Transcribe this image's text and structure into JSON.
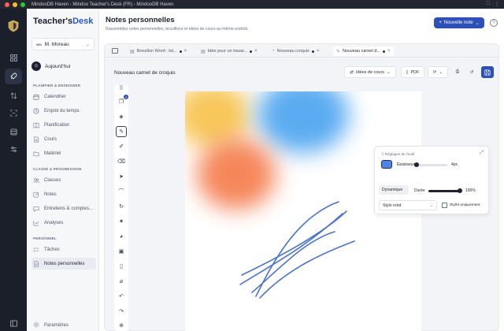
{
  "window": {
    "title": "MindooDB Haven - Mindoo Teacher's Desk (FR) - MindooDB Haven"
  },
  "brand": {
    "part1": "Teacher's",
    "part2": "Desk"
  },
  "user": {
    "initials": "MM",
    "name": "M. Moreau"
  },
  "today_label": "Aujourd'hui",
  "sections": {
    "plan": "PLANIFIER & ENSEIGNER",
    "class": "CLASSE & PROGRESSION",
    "personal": "PERSONNEL"
  },
  "nav": {
    "calendrier": "Calendrier",
    "emploi": "Emploi du temps",
    "planification": "Planification",
    "cours": "Cours",
    "materiel": "Matériel",
    "classes": "Classes",
    "notes": "Notes",
    "entretiens": "Entretiens & comptes...",
    "analyses": "Analyses",
    "taches": "Tâches",
    "notes_perso": "Notes personnelles",
    "parametres": "Paramètres"
  },
  "header": {
    "title": "Notes personnelles",
    "subtitle": "Rassemblez notes personnelles, brouillons et idées de cours au même endroit.",
    "new_note": "Nouvelle note",
    "help": "?"
  },
  "tabs": [
    {
      "label": "Brouillon Word : let..."
    },
    {
      "label": "Idée pour un travai..."
    },
    {
      "label": "Nouveau croquis"
    },
    {
      "label": "Nouveau carnet d..."
    }
  ],
  "document": {
    "title": "Nouveau carnet de croquis",
    "convert_label": "Idées de cours",
    "pdf_label": "PDF"
  },
  "tools": {
    "layer_badge": "2"
  },
  "tool_settings": {
    "header": "Réglages de l'outil",
    "thickness_label": "Épaisseur",
    "thickness_value": "4px",
    "thickness_fraction": 0.08,
    "dynamic_label": "Dynamique",
    "duration_label": "Durée",
    "duration_value": "100%",
    "duration_fraction": 1.0,
    "pen_style": "Stylo rond",
    "stylus_only_label": "Stylet uniquement",
    "stylus_only": false,
    "pen_color": "#4a86e8"
  },
  "colors": {
    "accent": "#2c4fb8",
    "stroke": "#4a74c9",
    "blob_yellow": "#f7c14a",
    "blob_blue": "#4aa3f0",
    "blob_orange": "#f47a48"
  }
}
